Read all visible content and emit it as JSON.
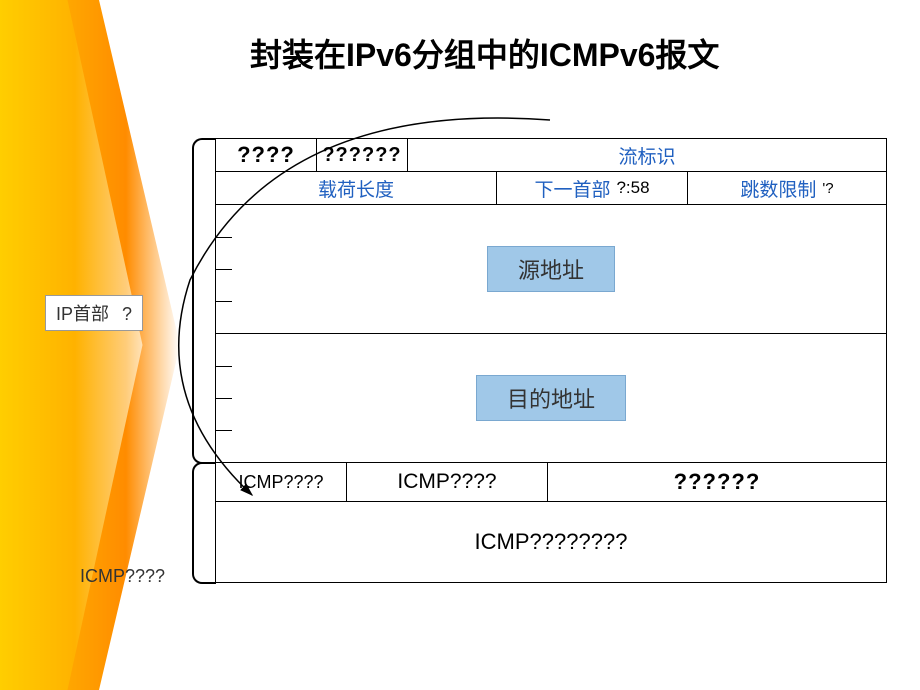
{
  "title": "封装在IPv6分组中的ICMPv6报文",
  "labels": {
    "ip_header": "IP首部",
    "ip_header_q": "?",
    "icmp_label": "ICMP????"
  },
  "ipv6": {
    "row1": {
      "version": "????",
      "traffic_class": "??????",
      "flow_label": "流标识"
    },
    "row2": {
      "payload_len": "载荷长度",
      "next_header": "下一首部",
      "next_header_val": "?:58",
      "hop_limit": "跳数限制",
      "hop_limit_q": "'?"
    },
    "src_addr": "源地址",
    "dst_addr": "目的地址"
  },
  "icmp": {
    "type": "ICMP????",
    "code": "ICMP????",
    "checksum": "??????",
    "data": "ICMP????????"
  }
}
